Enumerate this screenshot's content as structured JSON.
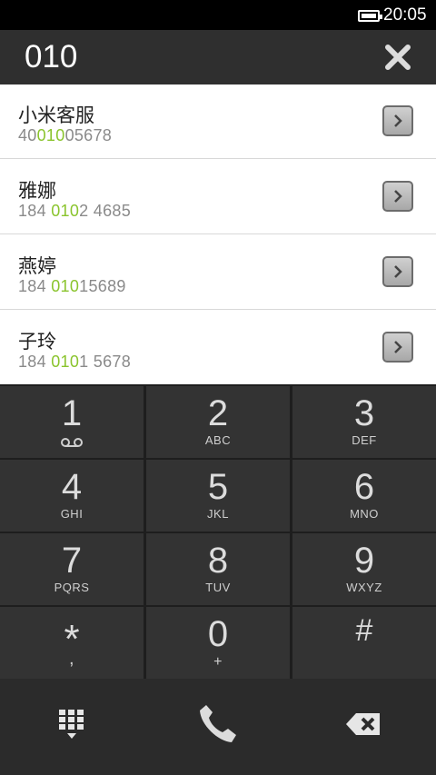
{
  "status_bar": {
    "time": "20:05",
    "battery_icon": "battery-icon"
  },
  "header": {
    "dialed_number": "010",
    "clear_icon": "close-icon"
  },
  "results": [
    {
      "name": "小米客服",
      "number_pre": "40",
      "number_match": "010",
      "number_post": "05678"
    },
    {
      "name": "雅娜",
      "number_pre": "184 ",
      "number_match": "010",
      "number_post": "2 4685"
    },
    {
      "name": "燕婷",
      "number_pre": "184 ",
      "number_match": "010",
      "number_post": "15689"
    },
    {
      "name": "子玲",
      "number_pre": "184 ",
      "number_match": "010",
      "number_post": "1 5678"
    }
  ],
  "keypad": {
    "keys": [
      {
        "digit": "1",
        "letters": ""
      },
      {
        "digit": "2",
        "letters": "ABC"
      },
      {
        "digit": "3",
        "letters": "DEF"
      },
      {
        "digit": "4",
        "letters": "GHI"
      },
      {
        "digit": "5",
        "letters": "JKL"
      },
      {
        "digit": "6",
        "letters": "MNO"
      },
      {
        "digit": "7",
        "letters": "PQRS"
      },
      {
        "digit": "8",
        "letters": "TUV"
      },
      {
        "digit": "9",
        "letters": "WXYZ"
      },
      {
        "digit": "*",
        "letters": ","
      },
      {
        "digit": "0",
        "letters": "+"
      },
      {
        "digit": "#",
        "letters": ""
      }
    ]
  },
  "bottom_bar": {
    "left_icon": "keypad-icon",
    "center_icon": "phone-icon",
    "right_icon": "backspace-icon"
  },
  "colors": {
    "highlight": "#8ac42d",
    "header_bg": "#2f2f2f",
    "key_bg": "#333333"
  }
}
